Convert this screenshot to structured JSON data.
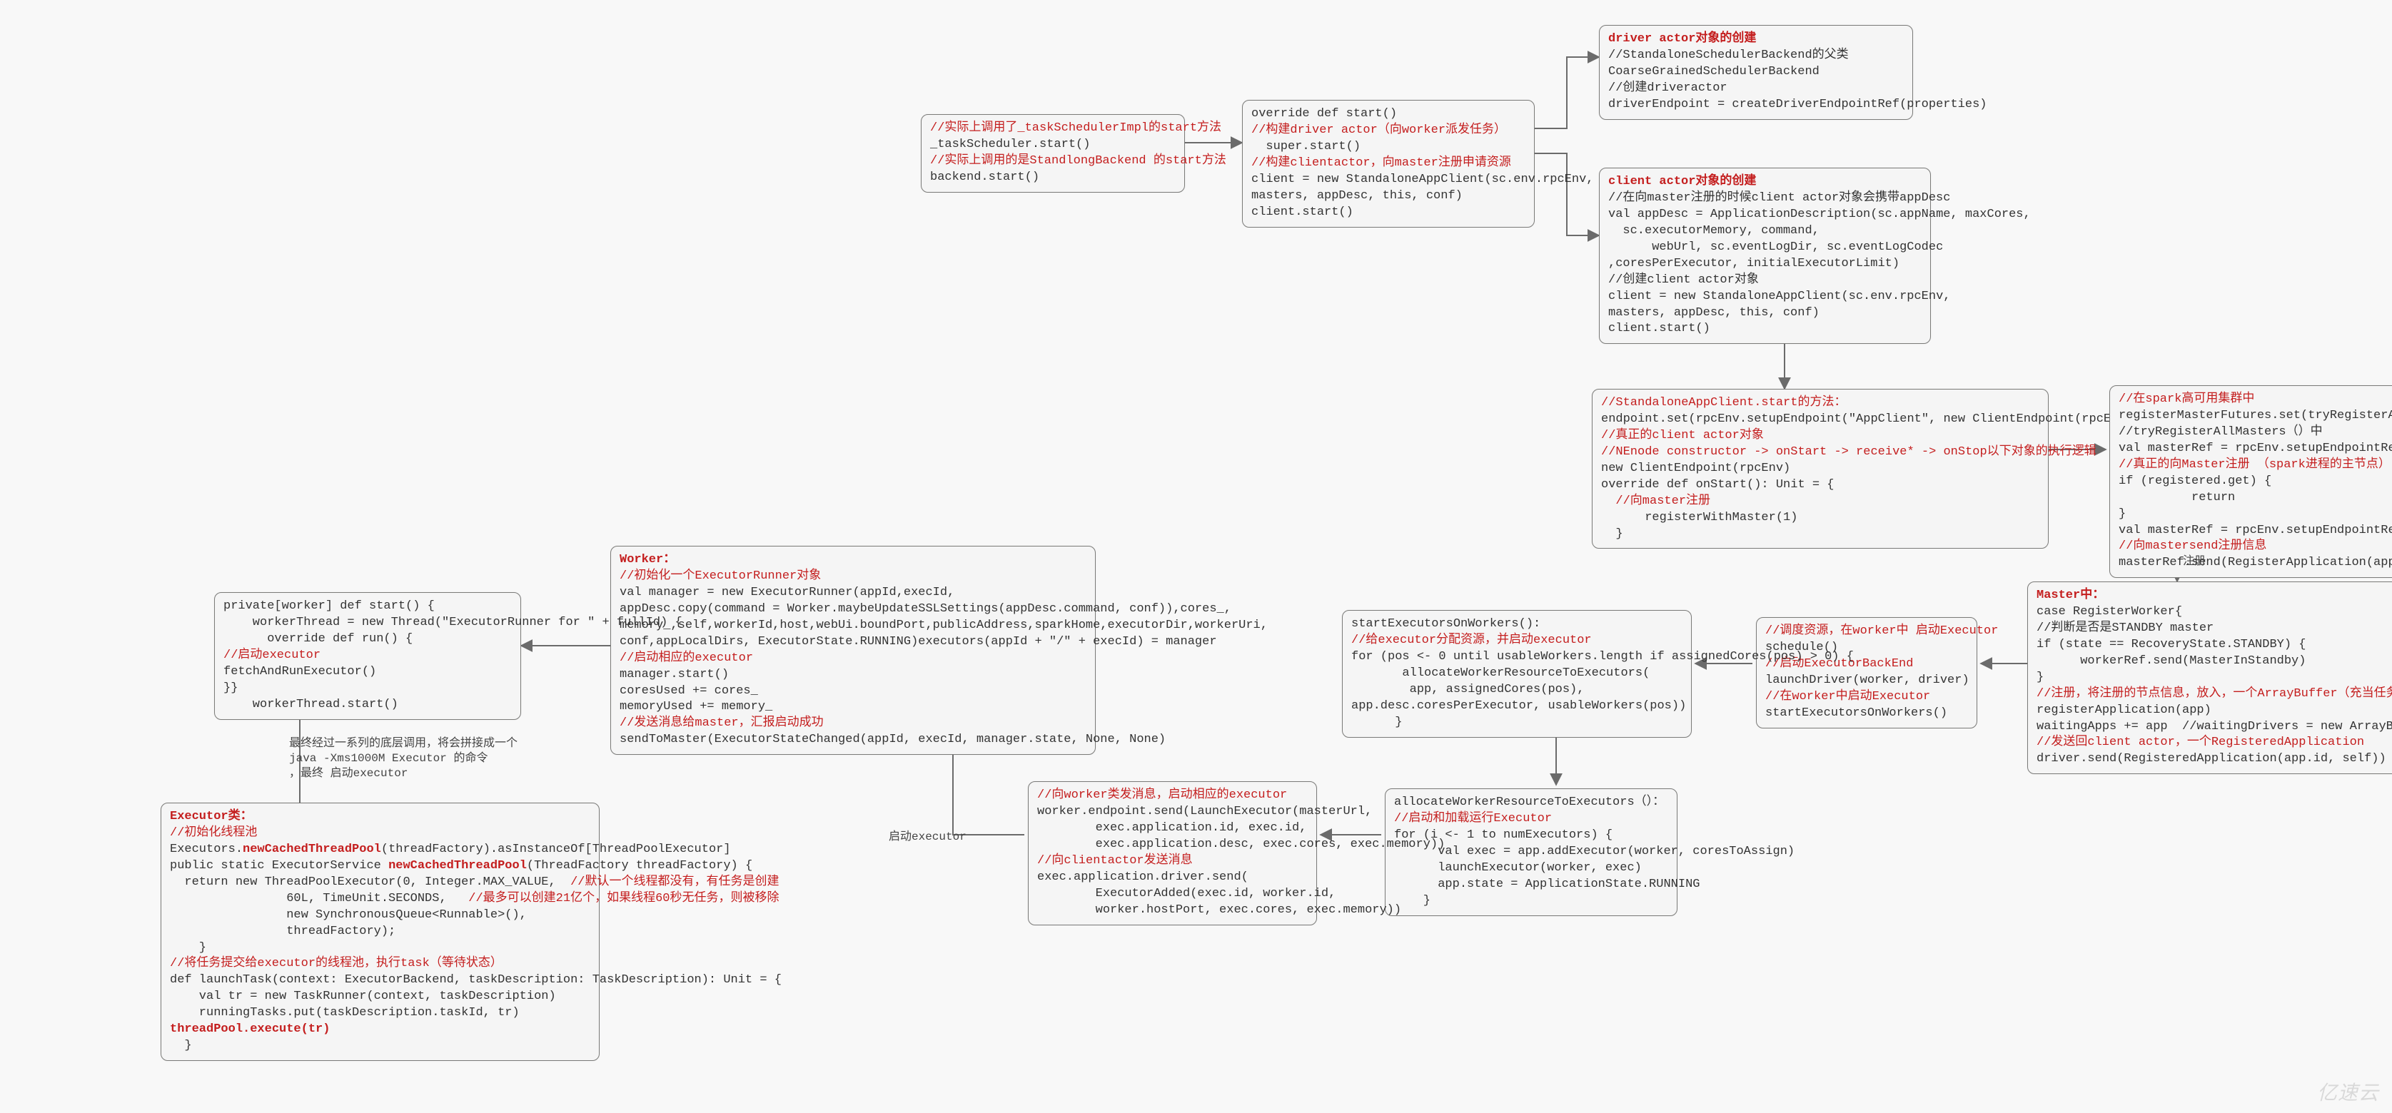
{
  "nodes": {
    "n1": {
      "lines": [
        {
          "t": "//实际上调用了_taskSchedulerImpl的start方法",
          "cls": "red"
        },
        {
          "t": "_taskScheduler.start()"
        },
        {
          "t": "//实际上调用的是StandlongBackend 的start方法",
          "cls": "red"
        },
        {
          "t": "backend.start()"
        }
      ]
    },
    "n2": {
      "lines": [
        {
          "t": "override def start()"
        },
        {
          "t": "//构建driver actor（向worker派发任务）",
          "cls": "red"
        },
        {
          "t": "  super.start()"
        },
        {
          "t": "//构建clientactor，向master注册申请资源",
          "cls": "red"
        },
        {
          "t": "client = new StandaloneAppClient(sc.env.rpcEnv,"
        },
        {
          "t": "masters, appDesc, this, conf)"
        },
        {
          "t": "client.start()"
        }
      ]
    },
    "n3": {
      "lines": [
        {
          "t": "driver actor对象的创建",
          "cls": "red bold"
        },
        {
          "t": "//StandaloneSchedulerBackend的父类"
        },
        {
          "t": "CoarseGrainedSchedulerBackend"
        },
        {
          "t": "//创建driveractor"
        },
        {
          "t": "driverEndpoint = createDriverEndpointRef(properties)"
        }
      ]
    },
    "n4": {
      "lines": [
        {
          "t": "client actor对象的创建",
          "cls": "red bold"
        },
        {
          "t": ""
        },
        {
          "t": "//在向master注册的时候client actor对象会携带appDesc"
        },
        {
          "t": "val appDesc = ApplicationDescription(sc.appName, maxCores,"
        },
        {
          "t": "  sc.executorMemory, command,"
        },
        {
          "t": "      webUrl, sc.eventLogDir, sc.eventLogCodec"
        },
        {
          "t": ",coresPerExecutor, initialExecutorLimit)"
        },
        {
          "t": "//创建client actor对象"
        },
        {
          "t": "client = new StandaloneAppClient(sc.env.rpcEnv,"
        },
        {
          "t": "masters, appDesc, this, conf)"
        },
        {
          "t": "client.start()"
        }
      ]
    },
    "n5": {
      "lines": [
        {
          "t": "//StandaloneAppClient.start的方法：",
          "cls": "red"
        },
        {
          "t": "endpoint.set(rpcEnv.setupEndpoint(\"AppClient\", new ClientEndpoint(rpcEnv)))"
        },
        {
          "t": "//真正的client actor对象",
          "cls": "red"
        },
        {
          "t": "//NEnode constructor -> onStart -> receive* -> onStop以下对象的执行逻辑",
          "cls": "red"
        },
        {
          "t": "new ClientEndpoint(rpcEnv)"
        },
        {
          "t": "override def onStart(): Unit = {"
        },
        {
          "t": "  //向master注册",
          "cls": "red"
        },
        {
          "t": "      registerWithMaster(1)"
        },
        {
          "t": "  }"
        }
      ]
    },
    "n6": {
      "lines": [
        {
          "t": "//在spark高可用集群中",
          "cls": "red"
        },
        {
          "t": "registerMasterFutures.set(tryRegisterAllMasters())"
        },
        {
          "t": "//tryRegisterAllMasters（）中"
        },
        {
          "t": "val masterRef = rpcEnv.setupEndpointRef(masterAddress, Master.ENDPOINT_NAME)"
        },
        {
          "t": "//真正的向Master注册 （spark进程的主节点）",
          "cls": "red"
        },
        {
          "t": "if (registered.get) {"
        },
        {
          "t": "          return"
        },
        {
          "t": "}"
        },
        {
          "t": "val masterRef = rpcEnv.setupEndpointRef(masterAddress, Master.ENDPOINT_NAME)"
        },
        {
          "t": "//向mastersend注册信息",
          "cls": "red"
        },
        {
          "t": "masterRef.send(RegisterApplication(appDescription, self))"
        }
      ]
    },
    "n7": {
      "lines": [
        {
          "t": "Master中：",
          "cls": "red bold"
        },
        {
          "t": "case RegisterWorker{"
        },
        {
          "t": "//判断是否是STANDBY master"
        },
        {
          "t": "if (state == RecoveryState.STANDBY) {"
        },
        {
          "t": "      workerRef.send(MasterInStandby)"
        },
        {
          "t": "}"
        },
        {
          "t": "//注册，将注册的节点信息，放入，一个ArrayBuffer（充当任务队列）",
          "cls": "red"
        },
        {
          "t": "registerApplication(app)"
        },
        {
          "t": "waitingApps += app  //waitingDrivers = new ArrayBuffer[DriverInfo]"
        },
        {
          "t": "//发送回client actor，一个RegisteredApplication",
          "cls": "red"
        },
        {
          "t": "driver.send(RegisteredApplication(app.id, self))"
        }
      ]
    },
    "n8": {
      "lines": [
        {
          "t": "//调度资源，在worker中 启动Executor",
          "cls": "red"
        },
        {
          "t": "schedule()"
        },
        {
          "t": "//启动ExecutorBackEnd",
          "cls": "red"
        },
        {
          "t": "launchDriver(worker, driver)"
        },
        {
          "t": "//在worker中启动Executor",
          "cls": "red"
        },
        {
          "t": "startExecutorsOnWorkers()"
        }
      ]
    },
    "n9": {
      "lines": [
        {
          "t": "startExecutorsOnWorkers():"
        },
        {
          "t": "//给executor分配资源，并启动executor",
          "cls": "red"
        },
        {
          "t": "for (pos <- 0 until usableWorkers.length if assignedCores(pos) > 0) {"
        },
        {
          "t": "       allocateWorkerResourceToExecutors("
        },
        {
          "t": "        app, assignedCores(pos),"
        },
        {
          "t": "app.desc.coresPerExecutor, usableWorkers(pos))"
        },
        {
          "t": "      }"
        }
      ]
    },
    "n10": {
      "lines": [
        {
          "t": "allocateWorkerResourceToExecutors（）："
        },
        {
          "t": "//启动和加载运行Executor",
          "cls": "red"
        },
        {
          "t": "for (i <- 1 to numExecutors) {"
        },
        {
          "t": "      val exec = app.addExecutor(worker, coresToAssign)"
        },
        {
          "t": "      launchExecutor(worker, exec)"
        },
        {
          "t": "      app.state = ApplicationState.RUNNING"
        },
        {
          "t": "    }"
        }
      ]
    },
    "n11": {
      "lines": [
        {
          "t": "//向worker类发消息，启动相应的executor",
          "cls": "red"
        },
        {
          "t": "worker.endpoint.send(LaunchExecutor(masterUrl,"
        },
        {
          "t": "        exec.application.id, exec.id,"
        },
        {
          "t": "        exec.application.desc, exec.cores, exec.memory))"
        },
        {
          "t": "//向clientactor发送消息",
          "cls": "red"
        },
        {
          "t": "exec.application.driver.send("
        },
        {
          "t": "        ExecutorAdded(exec.id, worker.id,"
        },
        {
          "t": "        worker.hostPort, exec.cores, exec.memory))"
        }
      ]
    },
    "n12": {
      "lines": [
        {
          "t": "Worker：",
          "cls": "red bold"
        },
        {
          "t": "//初始化一个ExecutorRunner对象",
          "cls": "red"
        },
        {
          "t": "val manager = new ExecutorRunner(appId,execId,"
        },
        {
          "t": "appDesc.copy(command = Worker.maybeUpdateSSLSettings(appDesc.command, conf)),cores_,"
        },
        {
          "t": "memory_,self,workerId,host,webUi.boundPort,publicAddress,sparkHome,executorDir,workerUri,"
        },
        {
          "t": "conf,appLocalDirs, ExecutorState.RUNNING)executors(appId + \"/\" + execId) = manager"
        },
        {
          "t": "//启动相应的executor",
          "cls": "red"
        },
        {
          "t": "manager.start()"
        },
        {
          "t": "coresUsed += cores_"
        },
        {
          "t": "memoryUsed += memory_"
        },
        {
          "t": "//发送消息给master，汇报启动成功",
          "cls": "red"
        },
        {
          "t": "sendToMaster(ExecutorStateChanged(appId, execId, manager.state, None, None)"
        }
      ]
    },
    "n13": {
      "lines": [
        {
          "t": "private[worker] def start() {"
        },
        {
          "t": "    workerThread = new Thread(\"ExecutorRunner for \" + fullId) {"
        },
        {
          "t": "      override def run() {"
        },
        {
          "t": "//启动executor",
          "cls": "red"
        },
        {
          "t": "fetchAndRunExecutor()"
        },
        {
          "t": "}}"
        },
        {
          "t": "    workerThread.start()"
        }
      ]
    },
    "n14": {
      "lines": [
        {
          "t": "Executor类：",
          "cls": "red bold"
        },
        {
          "t": "//初始化线程池",
          "cls": "red"
        },
        {
          "t": "Executors.newCachedThreadPool(threadFactory).asInstanceOf[ThreadPoolExecutor]",
          "partRed": "newCachedThreadPool"
        },
        {
          "t": ""
        },
        {
          "t": "public static ExecutorService newCachedThreadPool(ThreadFactory threadFactory) {",
          "partRed": "newCachedThreadPool"
        },
        {
          "t": "  return new ThreadPoolExecutor(0, Integer.MAX_VALUE,  //默认一个线程都没有，有任务是创建",
          "partRedTail": "//默认一个线程都没有，有任务是创建"
        },
        {
          "t": "                60L, TimeUnit.SECONDS,   //最多可以创建21亿个，如果线程60秒无任务，则被移除",
          "partRedTail": "//最多可以创建21亿个，如果线程60秒无任务，则被移除"
        },
        {
          "t": "                new SynchronousQueue<Runnable>(),"
        },
        {
          "t": "                threadFactory);"
        },
        {
          "t": "    }"
        },
        {
          "t": "//将任务提交给executor的线程池，执行task（等待状态）",
          "cls": "red"
        },
        {
          "t": "def launchTask(context: ExecutorBackend, taskDescription: TaskDescription): Unit = {"
        },
        {
          "t": "    val tr = new TaskRunner(context, taskDescription)"
        },
        {
          "t": "    runningTasks.put(taskDescription.taskId, tr)"
        },
        {
          "t": "threadPool.execute(tr)",
          "cls": "red bold"
        },
        {
          "t": "  }"
        }
      ]
    }
  },
  "edgeLabels": {
    "e1": "注册",
    "e2": "最终经过一系列的底层调用，将会拼接成一个\njava -Xms1000M Executor 的命令\n，最终 启动executor",
    "e3": "启动executor"
  },
  "watermark": "亿速云"
}
